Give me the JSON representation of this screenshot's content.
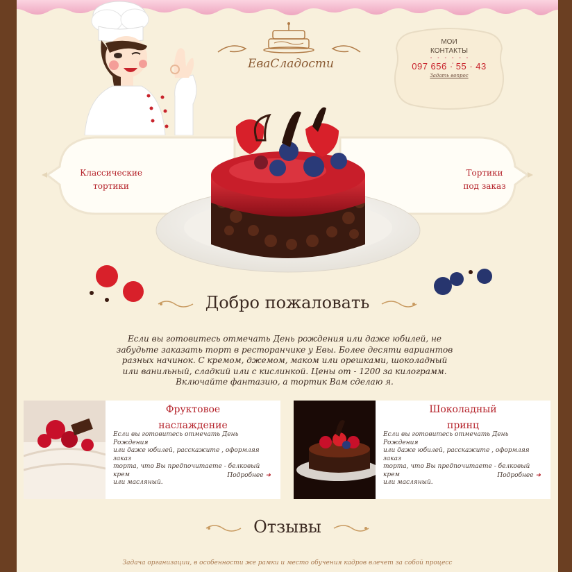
{
  "brand": {
    "logo_text": "ЕваСладости"
  },
  "contacts": {
    "label_line1": "МОИ",
    "label_line2": "КОНТАКТЫ",
    "phone": "097 656 · 55 · 43",
    "ask_link": "Задать вопрос"
  },
  "nav": {
    "left_line1": "Классические",
    "left_line2": "тортики",
    "right_line1": "Тортики",
    "right_line2": "под заказ"
  },
  "welcome": {
    "title": "Добро пожаловать",
    "text_lines": [
      "Если вы готовитесь отмечать День рождения или даже юбилей, не",
      "забудьте заказать торт в ресторанчике у Евы. Более десяти вариантов",
      "разных начинок. С кремом, джемом, маком или орешками, шоколадный",
      "или ванильный, сладкий или с кислинкой. Цены от - 1200 за килограмм.",
      "Включайте фантазию, а тортик Вам сделаю я."
    ]
  },
  "cards": [
    {
      "title_line1": "Фруктовое",
      "title_line2": "наслаждение",
      "text_lines": [
        "Если вы готовитесь отмечать День Рождения",
        "или даже юбилей, расскажите , оформляя заказ",
        "торта, что Вы предпочитаете - белковый крем",
        "или масляный."
      ],
      "more": "Подробнее"
    },
    {
      "title_line1": "Шоколадный",
      "title_line2": "принц",
      "text_lines": [
        "Если вы готовитесь отмечать День Рождения",
        "или даже юбилей, расскажите , оформляя заказ",
        "торта, что Вы предпочитаете - белковый крем",
        "или масляный."
      ],
      "more": "Подробнее"
    }
  ],
  "reviews": {
    "title": "Отзывы",
    "first_line": "Задача организации, в особенности же рамки и место обучения кадров влечет за собой процесс"
  },
  "colors": {
    "accent_red": "#b5232b",
    "phone_red": "#c8232c",
    "background": "#f8f0dc",
    "frame_brown": "#6b3f22",
    "drip_pink": "#f2b8cc"
  },
  "icons": {
    "chef": "chef-illustration",
    "cake": "berry-cake-image",
    "more_arrow": "arrow-right-icon"
  }
}
